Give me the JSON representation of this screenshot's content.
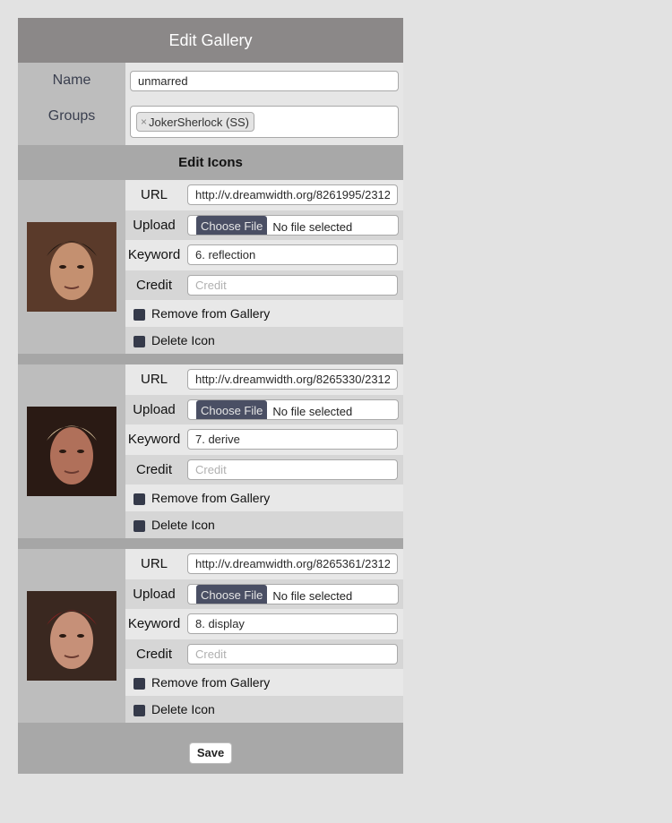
{
  "header": {
    "title": "Edit Gallery"
  },
  "gallery": {
    "name_label": "Name",
    "name_value": "unmarred",
    "groups_label": "Groups",
    "groups": [
      {
        "remove_glyph": "×",
        "label": "JokerSherlock (SS)"
      }
    ]
  },
  "edit_icons": {
    "heading": "Edit Icons",
    "labels": {
      "url": "URL",
      "upload": "Upload",
      "keyword": "Keyword",
      "credit": "Credit",
      "choose_file": "Choose File",
      "no_file": "No file selected",
      "credit_placeholder": "Credit",
      "remove_from_gallery": "Remove from Gallery",
      "delete_icon": "Delete Icon"
    },
    "icons": [
      {
        "url": "http://v.dreamwidth.org/8261995/2312",
        "keyword": "6. reflection",
        "credit": "",
        "remove_from_gallery": false,
        "delete_icon": false,
        "image_tones": [
          "#5a3a2a",
          "#c49070",
          "#1a1410"
        ]
      },
      {
        "url": "http://v.dreamwidth.org/8265330/2312",
        "keyword": "7. derive",
        "credit": "",
        "remove_from_gallery": false,
        "delete_icon": false,
        "image_tones": [
          "#2a1a14",
          "#b0705a",
          "#e0c8a0"
        ]
      },
      {
        "url": "http://v.dreamwidth.org/8265361/2312",
        "keyword": "8. display",
        "credit": "",
        "remove_from_gallery": false,
        "delete_icon": false,
        "image_tones": [
          "#3a2820",
          "#c69078",
          "#8a2020"
        ]
      }
    ]
  },
  "footer": {
    "save_label": "Save"
  }
}
